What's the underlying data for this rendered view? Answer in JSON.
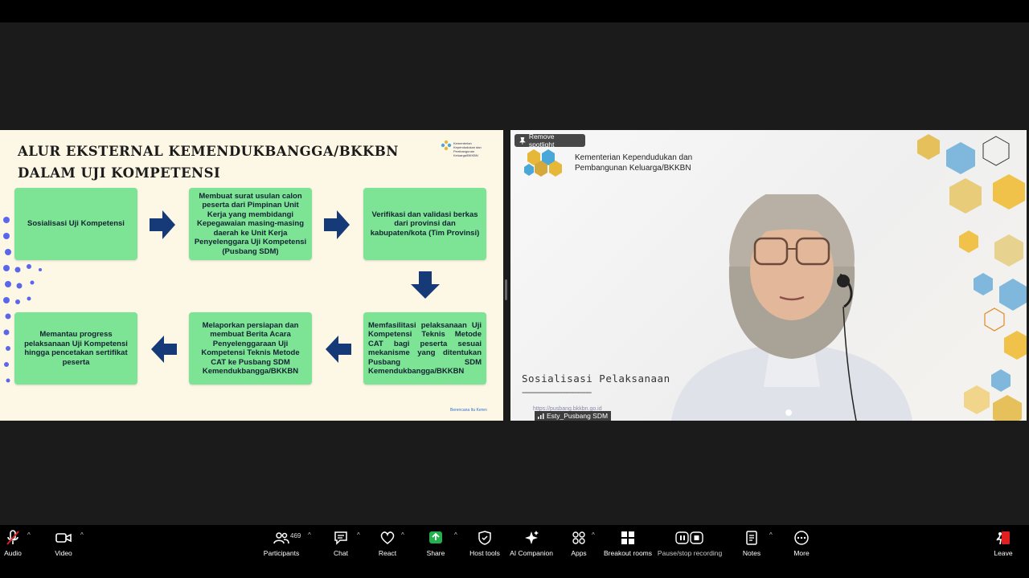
{
  "slide": {
    "title_line1": "ALUR EKSTERNAL KEMENDUKBANGGA/BKKBN",
    "title_line2": "DALAM UJI KOMPETENSI",
    "logo_text": "Kementerian Kependudukan dan Pembangunan Keluarga/BKKBN",
    "footer": "Berencana Itu Keren",
    "steps": [
      "Sosialisasi Uji Kompetensi",
      "Membuat surat usulan calon peserta dari Pimpinan Unit Kerja yang membidangi Kepegawaian masing-masing daerah ke Unit Kerja Penyelenggara Uji Kompetensi (Pusbang SDM)",
      "Verifikasi dan validasi berkas dari provinsi dan kabupaten/kota (Tim Provinsi)",
      "Memfasilitasi pelaksanaan Uji Kompetensi Teknis Metode CAT bagi peserta sesuai mekanisme yang ditentukan Pusbang SDM Kemendukbangga/BKKBN",
      "Melaporkan persiapan dan membuat Berita Acara Penyelenggaraan Uji Kompetensi Teknis Metode CAT ke Pusbang SDM Kemendukbangga/BKKBN",
      "Memantau progress pelaksanaan Uji Kompetensi hingga pencetakan sertifikat peserta"
    ],
    "colors": {
      "box": "#7ee495",
      "arrow": "#163a78",
      "dots": "#5b67e8"
    }
  },
  "video": {
    "spotlight_label": "Remove spotlight",
    "org_name_line1": "Kementerian Kependudukan dan",
    "org_name_line2": "Pembangunan Keluarga/BKKBN",
    "caption": "Sosialisasi Pelaksanaan",
    "caption_rule": "-------------------------------------",
    "url": "https://pusbang.bkkbn.go.id",
    "participant_name": "Esty_Pusbang SDM"
  },
  "toolbar": {
    "audio": "Audio",
    "video": "Video",
    "participants": "Participants",
    "participant_count": "469",
    "chat": "Chat",
    "react": "React",
    "share": "Share",
    "host_tools": "Host tools",
    "ai_companion": "AI Companion",
    "apps": "Apps",
    "breakout_rooms": "Breakout rooms",
    "recording": "Pause/stop recording",
    "notes": "Notes",
    "more": "More",
    "leave": "Leave",
    "share_color": "#22b14c",
    "leave_color": "#e02020"
  }
}
